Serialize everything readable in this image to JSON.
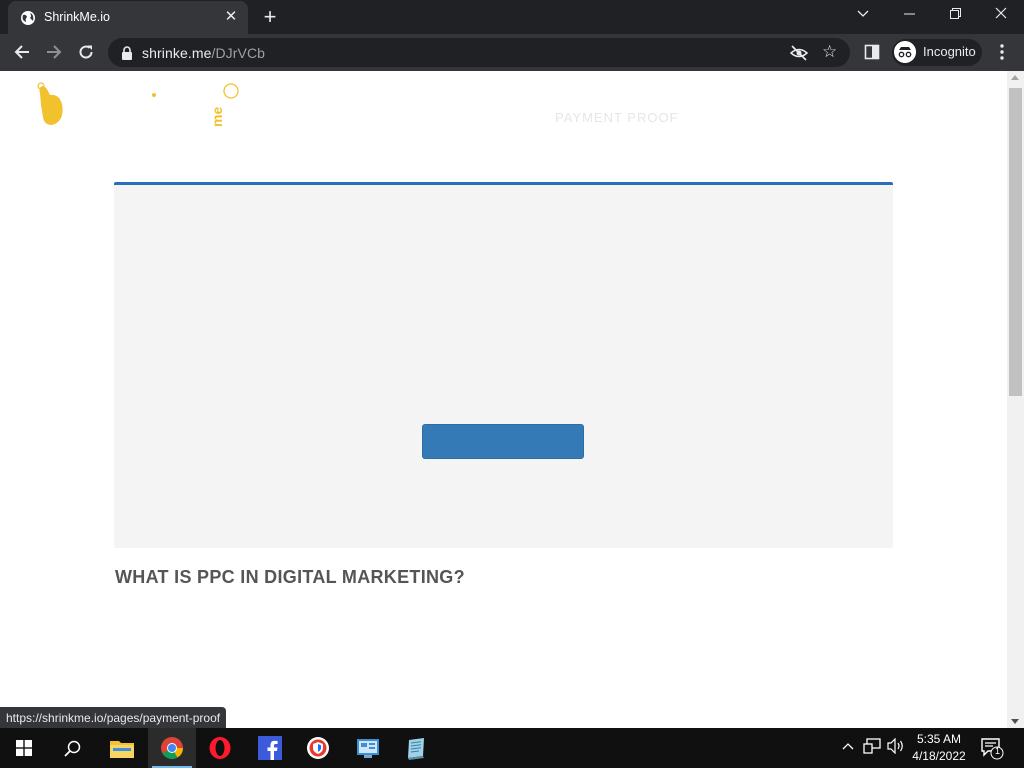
{
  "browser": {
    "tab_title": "ShrinkMe.io",
    "tab_close_glyph": "✕",
    "new_tab_glyph": "+",
    "url_host": "shrinke.me",
    "url_path": "/DJrVCb",
    "incognito_label": "Incognito",
    "status_url": "https://shrinkme.io/pages/payment-proof",
    "accent_color": "#35363a"
  },
  "page": {
    "nav_link": "PAYMENT PROOF",
    "cta_label": "",
    "article_heading": "WHAT IS PPC IN DIGITAL MARKETING?",
    "box_accent": "#2a6ebb",
    "button_color": "#337ab7",
    "logo_color": "#f2c12e"
  },
  "taskbar": {
    "apps": [
      "file-explorer",
      "chrome",
      "opera",
      "facebook",
      "vpn",
      "control-panel",
      "notepad"
    ],
    "time": "5:35 AM",
    "date": "4/18/2022",
    "notification_count": "1"
  }
}
